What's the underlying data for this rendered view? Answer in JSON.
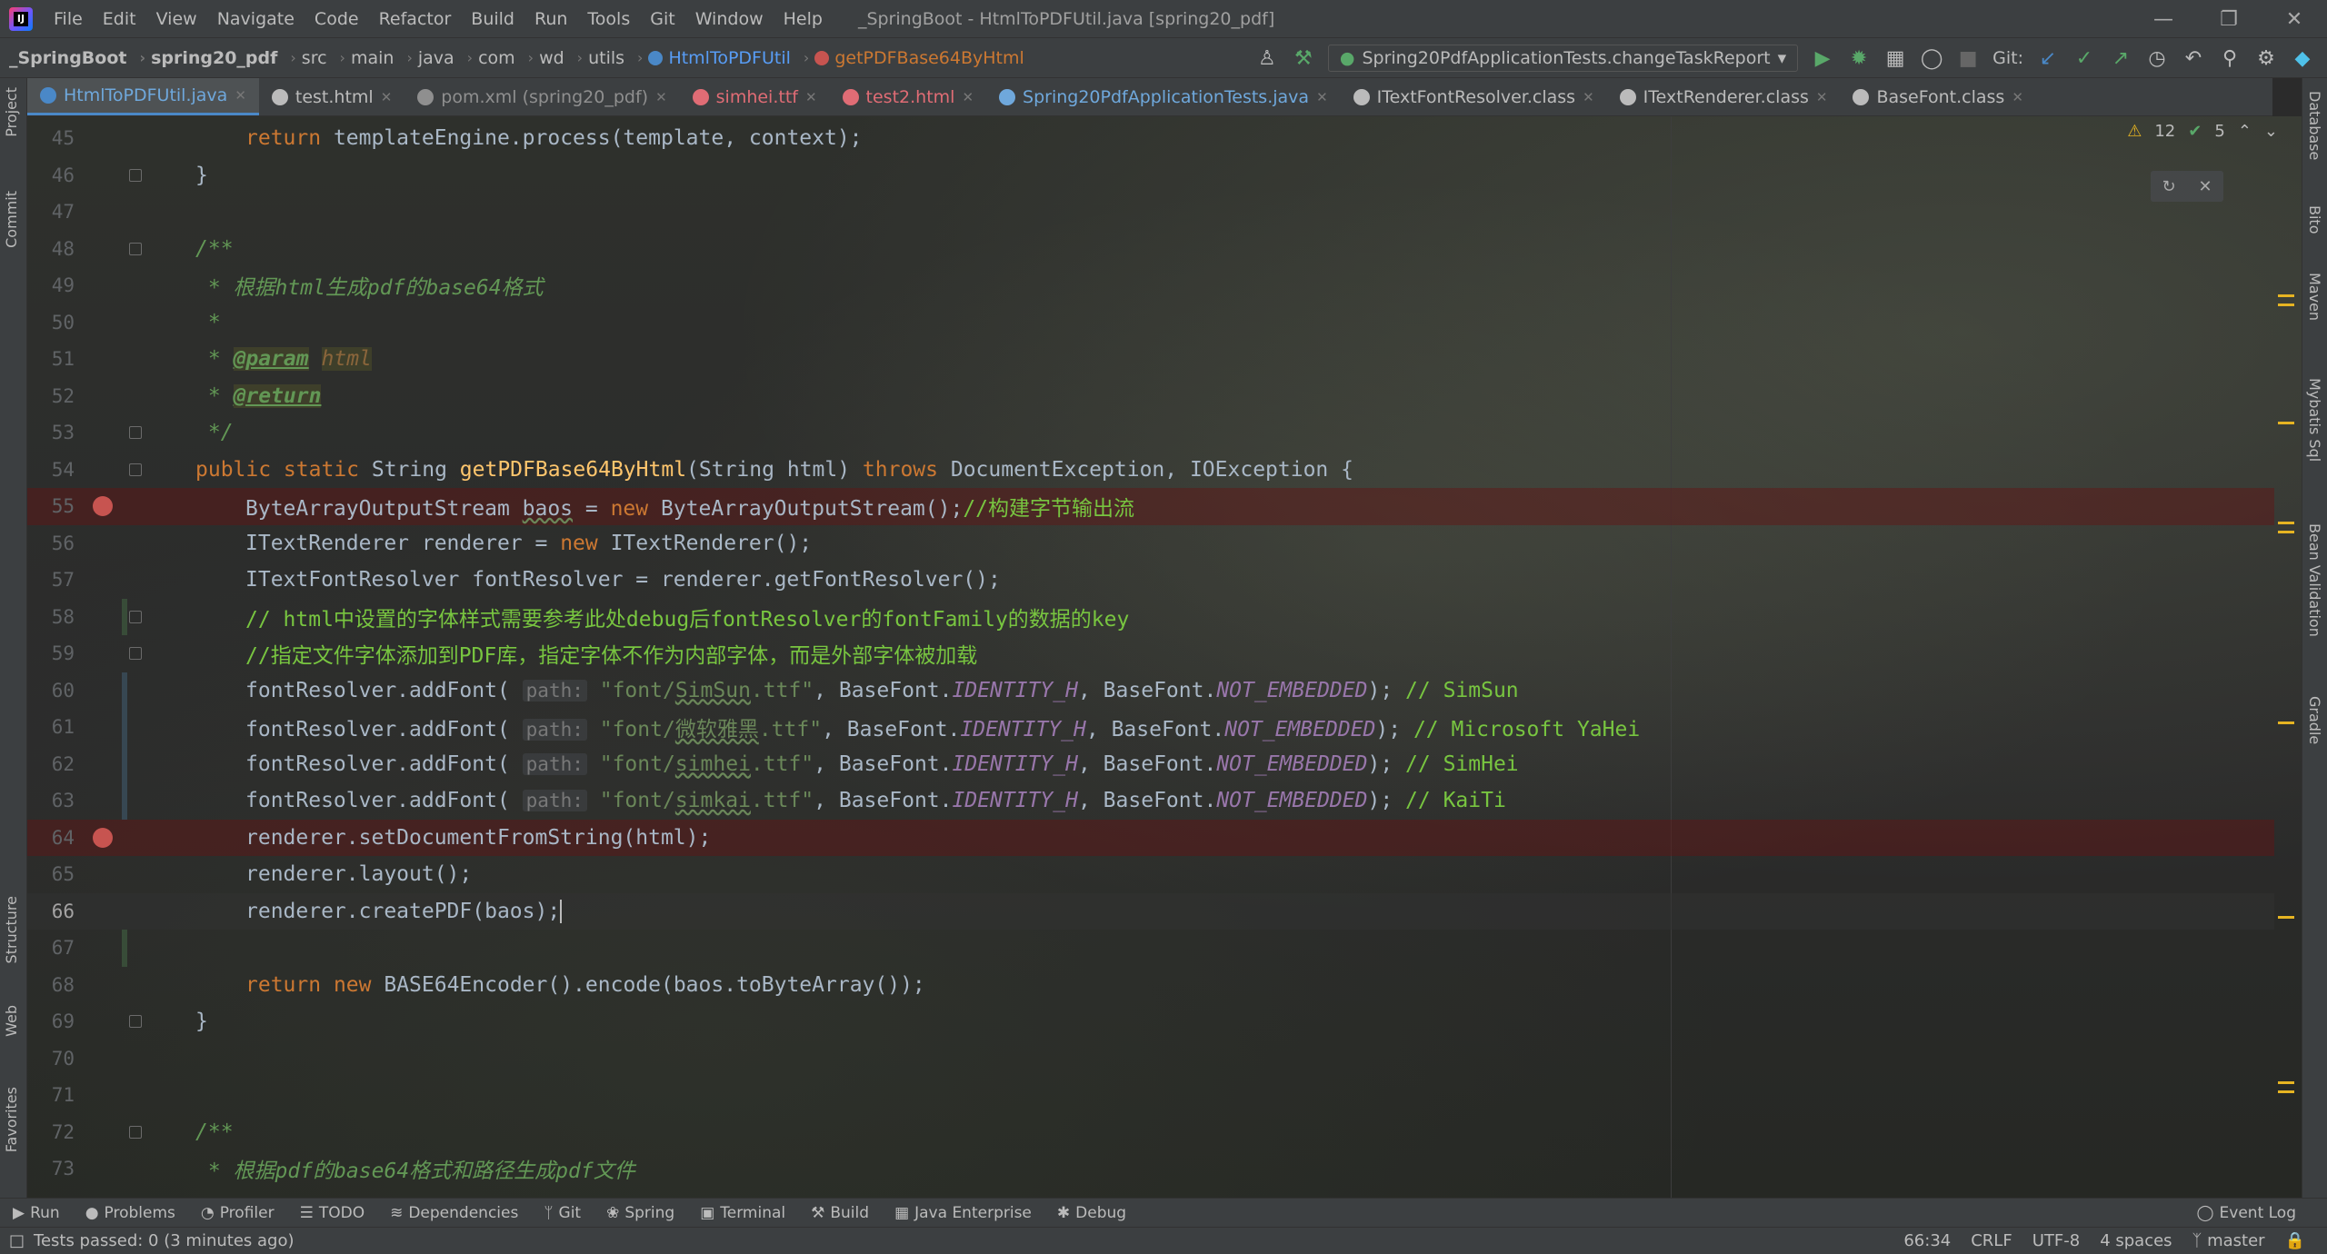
{
  "menu": {
    "items": [
      "File",
      "Edit",
      "View",
      "Navigate",
      "Code",
      "Refactor",
      "Build",
      "Run",
      "Tools",
      "Git",
      "Window",
      "Help"
    ],
    "window_title": "_SpringBoot - HtmlToPDFUtil.java [spring20_pdf]"
  },
  "breadcrumb": {
    "items": [
      "_SpringBoot",
      "spring20_pdf",
      "src",
      "main",
      "java",
      "com",
      "wd",
      "utils"
    ],
    "class_name": "HtmlToPDFUtil",
    "method_name": "getPDFBase64ByHtml"
  },
  "toolbar": {
    "run_config": "Spring20PdfApplicationTests.changeTaskReport",
    "git_label": "Git:"
  },
  "tabs": [
    {
      "label": "HtmlToPDFUtil.java",
      "icon": "java-class-icon",
      "color": "#4a88c7",
      "active": true
    },
    {
      "label": "test.html",
      "icon": "html-file-icon",
      "color": "#bbbbbb",
      "active": false
    },
    {
      "label": "pom.xml (spring20_pdf)",
      "icon": "maven-icon",
      "color": "#8f8f8f",
      "active": false
    },
    {
      "label": "simhei.ttf",
      "icon": "font-file-icon",
      "color": "#e06c75",
      "active": false
    },
    {
      "label": "test2.html",
      "icon": "html-file-icon",
      "color": "#e06c75",
      "active": false
    },
    {
      "label": "Spring20PdfApplicationTests.java",
      "icon": "test-class-icon",
      "color": "#6fa8dc",
      "active": false
    },
    {
      "label": "ITextFontResolver.class",
      "icon": "class-icon",
      "color": "#bbbbbb",
      "active": false
    },
    {
      "label": "ITextRenderer.class",
      "icon": "class-icon",
      "color": "#bbbbbb",
      "active": false
    },
    {
      "label": "BaseFont.class",
      "icon": "class-icon",
      "color": "#bbbbbb",
      "active": false
    }
  ],
  "left_tools": [
    "Project",
    "Commit",
    "Structure",
    "Web",
    "Favorites"
  ],
  "right_tools": [
    "Database",
    "Bito",
    "Maven",
    "Mybatis Sql",
    "Bean Validation",
    "Gradle"
  ],
  "inspection": {
    "warnings": "12",
    "ok": "5"
  },
  "editor": {
    "current_line": "66",
    "lines": [
      {
        "n": "45"
      },
      {
        "n": "46"
      },
      {
        "n": "47"
      },
      {
        "n": "48"
      },
      {
        "n": "49"
      },
      {
        "n": "50"
      },
      {
        "n": "51"
      },
      {
        "n": "52"
      },
      {
        "n": "53"
      },
      {
        "n": "54"
      },
      {
        "n": "55"
      },
      {
        "n": "56"
      },
      {
        "n": "57"
      },
      {
        "n": "58"
      },
      {
        "n": "59"
      },
      {
        "n": "60"
      },
      {
        "n": "61"
      },
      {
        "n": "62"
      },
      {
        "n": "63"
      },
      {
        "n": "64"
      },
      {
        "n": "65"
      },
      {
        "n": "66"
      },
      {
        "n": "67"
      },
      {
        "n": "68"
      },
      {
        "n": "69"
      },
      {
        "n": "70"
      },
      {
        "n": "71"
      },
      {
        "n": "72"
      },
      {
        "n": "73"
      }
    ],
    "code": {
      "l45_kw": "return",
      "l45_rest": " templateEngine.process(template, context);",
      "l46": "}",
      "l48": "/**",
      "l49": " * 根据html生成pdf的base64格式",
      "l50": " *",
      "l51_pre": " * ",
      "l51_tag": "@param",
      "l51_param": "html",
      "l52_pre": " * ",
      "l52_tag": "@return",
      "l53": " */",
      "l54_kw1": "public static",
      "l54_type": " String ",
      "l54_fn": "getPDFBase64ByHtml",
      "l54_args": "(String html) ",
      "l54_kw2": "throws",
      "l54_ex": " DocumentException, IOException {",
      "l55_a": "ByteArrayOutputStream ",
      "l55_var": "baos",
      "l55_b": " = ",
      "l55_kw": "new",
      "l55_c": " ByteArrayOutputStream();",
      "l55_cmt": "//构建字节输出流",
      "l56_a": "ITextRenderer renderer = ",
      "l56_kw": "new",
      "l56_b": " ITextRenderer();",
      "l57": "ITextFontResolver fontResolver = renderer.getFontResolver();",
      "l58": "// html中设置的字体样式需要参考此处debug后fontResolver的fontFamily的数据的key",
      "l59": "//指定文件字体添加到PDF库，指定字体不作为内部字体，而是外部字体被加载",
      "font_lines": [
        {
          "str_a": "\"font/",
          "str_u": "SimSun",
          "str_b": ".ttf\"",
          "cmt": "// SimSun"
        },
        {
          "str_a": "\"font/",
          "str_u": "微软雅黑",
          "str_b": ".ttf\"",
          "cmt": "// Microsoft YaHei"
        },
        {
          "str_a": "\"font/",
          "str_u": "simhei",
          "str_b": ".ttf\"",
          "cmt": "// SimHei"
        },
        {
          "str_a": "\"font/",
          "str_u": "simkai",
          "str_b": ".ttf\"",
          "cmt": "// KaiTi"
        }
      ],
      "font_call": "fontResolver.addFont(",
      "font_hint": "path:",
      "font_mid_a": ", BaseFont.",
      "font_const1": "IDENTITY_H",
      "font_mid_b": ", BaseFont.",
      "font_const2": "NOT_EMBEDDED",
      "font_end": "); ",
      "l64": "renderer.setDocumentFromString(html);",
      "l65": "renderer.layout();",
      "l66": "renderer.createPDF(baos);",
      "l68_kw1": "return",
      "l68_sp": " ",
      "l68_kw2": "new",
      "l68_rest": " BASE64Encoder().encode(baos.toByteArray());",
      "l69": "}",
      "l72": "/**",
      "l73": " * 根据pdf的base64格式和路径生成pdf文件"
    }
  },
  "bottom_tools": [
    "Run",
    "Problems",
    "Profiler",
    "TODO",
    "Dependencies",
    "Git",
    "Spring",
    "Terminal",
    "Build",
    "Java Enterprise",
    "Debug"
  ],
  "event_log": "Event Log",
  "status": {
    "message": "Tests passed: 0 (3 minutes ago)",
    "position": "66:34",
    "line_sep": "CRLF",
    "encoding": "UTF-8",
    "indent": "4 spaces",
    "branch": "master"
  }
}
